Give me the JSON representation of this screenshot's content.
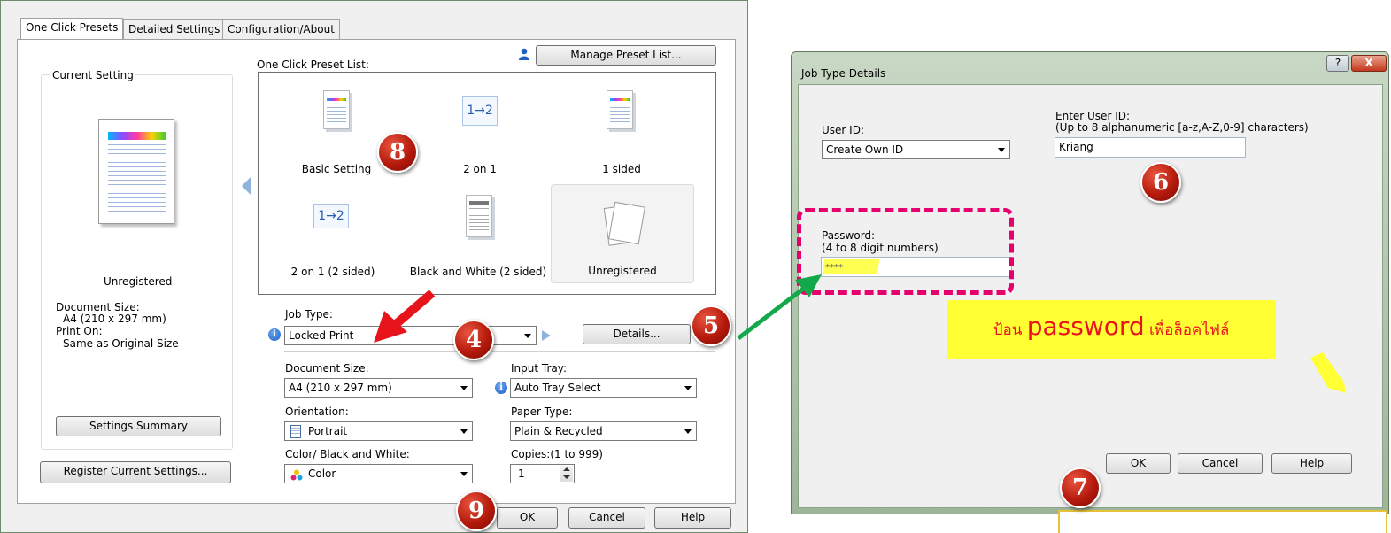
{
  "left_dialog": {
    "tabs": [
      "One Click Presets",
      "Detailed Settings",
      "Configuration/About"
    ],
    "current_setting": {
      "group_label": "Current Setting",
      "preset_name": "Unregistered",
      "doc_size_label": "Document Size:",
      "doc_size_value": "A4 (210 x 297 mm)",
      "print_on_label": "Print On:",
      "print_on_value": "Same as Original Size",
      "summary_button": "Settings Summary"
    },
    "register_button": "Register Current Settings...",
    "manage_button": "Manage Preset List...",
    "preset_list_label": "One Click Preset List:",
    "presets": [
      "Basic Setting",
      "2 on 1",
      "1 sided",
      "2 on 1 (2 sided)",
      "Black and White (2 sided)",
      "Unregistered"
    ],
    "two_on_one_glyph": "1→2",
    "job_type_label": "Job Type:",
    "job_type_value": "Locked Print",
    "details_button": "Details...",
    "document_size_label": "Document Size:",
    "document_size_value": "A4 (210 x 297 mm)",
    "input_tray_label": "Input Tray:",
    "input_tray_value": "Auto Tray Select",
    "orientation_label": "Orientation:",
    "orientation_value": "Portrait",
    "paper_type_label": "Paper Type:",
    "paper_type_value": "Plain & Recycled",
    "color_label": "Color/ Black and White:",
    "color_value": "Color",
    "copies_label": "Copies:(1 to 999)",
    "copies_value": "1",
    "ok_button": "OK",
    "cancel_button": "Cancel",
    "help_button": "Help"
  },
  "right_dialog": {
    "title": "Job Type Details",
    "user_id_label": "User ID:",
    "user_id_value": "Create Own ID",
    "enter_user_id_label": "Enter User ID:",
    "enter_user_id_hint": "(Up to 8 alphanumeric [a-z,A-Z,0-9] characters)",
    "enter_user_id_value": "Kriang",
    "password_label": "Password:",
    "password_hint": "(4 to 8 digit numbers)",
    "password_value": "****",
    "ok_button": "OK",
    "cancel_button": "Cancel",
    "help_button": "Help",
    "help_glyph": "?",
    "close_glyph": "X"
  },
  "annotation": {
    "callout_thai_prefix": "ป้อน ",
    "callout_keyword": "password",
    "callout_thai_suffix": " เพื่อล็อคไฟล์"
  },
  "badges": [
    "8",
    "4",
    "5",
    "6",
    "7",
    "9"
  ],
  "colors": {
    "badge_red": "#b51a0c",
    "highlight_pink": "#e6006e",
    "callout_yellow": "#ffff33",
    "arrow_green": "#13a94a",
    "arrow_red": "#e8141c",
    "callout_text_red": "#e8141c"
  }
}
